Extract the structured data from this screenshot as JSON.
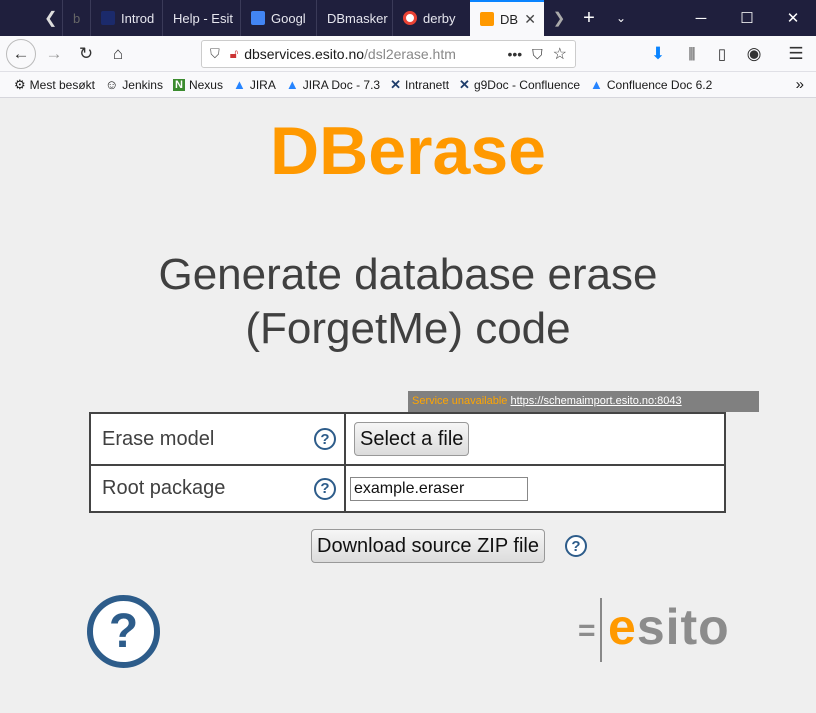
{
  "tabs": [
    {
      "label": "b",
      "color": "#3b3b59"
    },
    {
      "label": "Introd",
      "color": "#1b2a6b"
    },
    {
      "label": "Help - Esit",
      "color": "#ffffff"
    },
    {
      "label": "Googl",
      "color": "#4285f4"
    },
    {
      "label": "DBmasker",
      "color": "#ffffff"
    },
    {
      "label": "derby",
      "color": "#ea4335"
    },
    {
      "label": "DB",
      "color": "#ff9900"
    }
  ],
  "nav": {
    "url_host": "dbservices.esito.no",
    "url_path": "/dsl2erase.htm"
  },
  "bookmarks": [
    {
      "label": "Mest besøkt",
      "icon": "⚙"
    },
    {
      "label": "Jenkins",
      "icon": "☺"
    },
    {
      "label": "Nexus",
      "icon": "N"
    },
    {
      "label": "JIRA",
      "icon": "▲"
    },
    {
      "label": "JIRA Doc - 7.3",
      "icon": "▲"
    },
    {
      "label": "Intranett",
      "icon": "✕"
    },
    {
      "label": "g9Doc - Confluence",
      "icon": "✕"
    },
    {
      "label": "Confluence Doc 6.2",
      "icon": "▲"
    }
  ],
  "page": {
    "title": "DBerase",
    "subtitle_line1": "Generate database erase",
    "subtitle_line2": "(ForgetMe) code",
    "status_label": "Service unavailable",
    "status_link": "https://schemaimport.esito.no:8043",
    "form": {
      "erase_model_label": "Erase model",
      "select_file_label": "Select a file",
      "root_package_label": "Root package",
      "root_package_value": "example.eraser"
    },
    "download_label": "Download source ZIP file",
    "help_glyph": "?",
    "logo_e": "e",
    "logo_rest": "sito"
  },
  "colors": {
    "title_orange": "#ff9900",
    "help_blue": "#2d5c8a",
    "logo_gray": "#8c8c8c"
  }
}
